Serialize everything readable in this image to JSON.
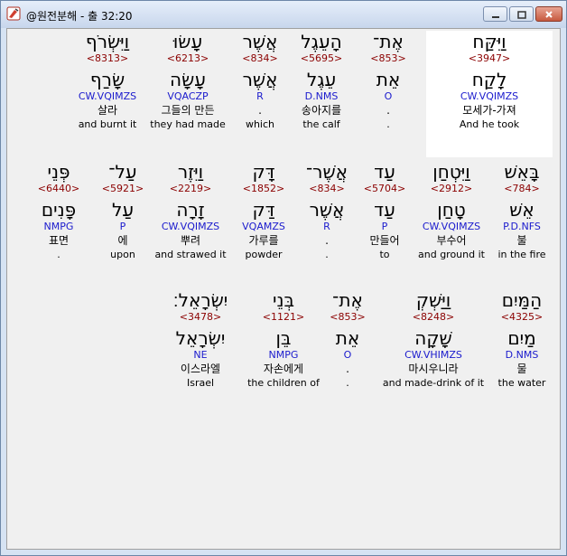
{
  "window": {
    "title": "@원전분해 - 출 32:20",
    "icon": "app-icon",
    "controls": [
      "minimize-icon",
      "maximize-icon",
      "close-icon"
    ]
  },
  "rows": [
    [
      {
        "heb": "וַיִּקַּח",
        "num": "<3947>",
        "lemma": "לָקַח",
        "morph": "CW.VQIMZS",
        "kor": "모세가-가져",
        "eng": "And he took",
        "highlight": true
      },
      {
        "heb": "אֶת־",
        "num": "<853>",
        "lemma": "אֵת",
        "morph": "O",
        "kor": ".",
        "eng": "."
      },
      {
        "heb": "הָעֵגֶל",
        "num": "<5695>",
        "lemma": "עֵגֶל",
        "morph": "D.NMS",
        "kor": "송아지를",
        "eng": "the calf"
      },
      {
        "heb": "אֲשֶׁר",
        "num": "<834>",
        "lemma": "אֲשֶׁר",
        "morph": "R",
        "kor": ".",
        "eng": "which"
      },
      {
        "heb": "עָשׂוּ",
        "num": "<6213>",
        "lemma": "עָשָׂה",
        "morph": "VQACZP",
        "kor": "그들의 만든",
        "eng": "they had made"
      },
      {
        "heb": "וַיִּשְׂרֹף",
        "num": "<8313>",
        "lemma": "שָׂרַף",
        "morph": "CW.VQIMZS",
        "kor": "살라",
        "eng": "and burnt it"
      }
    ],
    [
      {
        "heb": "בָּאֵשׁ",
        "num": "<784>",
        "lemma": "אֵשׁ",
        "morph": "P.D.NFS",
        "kor": "불",
        "eng": "in the fire"
      },
      {
        "heb": "וַיִּטְחַן",
        "num": "<2912>",
        "lemma": "טָחַן",
        "morph": "CW.VQIMZS",
        "kor": "부수어",
        "eng": "and ground it"
      },
      {
        "heb": "עַד",
        "num": "<5704>",
        "lemma": "עַד",
        "morph": "P",
        "kor": "만들어",
        "eng": "to"
      },
      {
        "heb": "אֲשֶׁר־",
        "num": "<834>",
        "lemma": "אֲשֶׁר",
        "morph": "R",
        "kor": ".",
        "eng": "."
      },
      {
        "heb": "דָּק",
        "num": "<1852>",
        "lemma": "דַּק",
        "morph": "VQAMZS",
        "kor": "가루를",
        "eng": "powder"
      },
      {
        "heb": "וַיִּזֶר",
        "num": "<2219>",
        "lemma": "זָרָה",
        "morph": "CW.VQIMZS",
        "kor": "뿌려",
        "eng": "and strawed it"
      },
      {
        "heb": "עַל־",
        "num": "<5921>",
        "lemma": "עַל",
        "morph": "P",
        "kor": "에",
        "eng": "upon"
      },
      {
        "heb": "פְּנֵי",
        "num": "<6440>",
        "lemma": "פָּנִים",
        "morph": "NMPG",
        "kor": "표면",
        "eng": "."
      }
    ],
    [
      {
        "heb": "הַמַּיִם",
        "num": "<4325>",
        "lemma": "מַיִם",
        "morph": "D.NMS",
        "kor": "물",
        "eng": "the water"
      },
      {
        "heb": "וַיַּשְׁקְ",
        "num": "<8248>",
        "lemma": "שָׁקָה",
        "morph": "CW.VHIMZS",
        "kor": "마시우니라",
        "eng": "and made-drink of it"
      },
      {
        "heb": "אֶת־",
        "num": "<853>",
        "lemma": "אֵת",
        "morph": "O",
        "kor": ".",
        "eng": "."
      },
      {
        "heb": "בְּנֵי",
        "num": "<1121>",
        "lemma": "בֵּן",
        "morph": "NMPG",
        "kor": "자손에게",
        "eng": "the children of"
      },
      {
        "heb": "יִשְׂרָאֵל׃",
        "num": "<3478>",
        "lemma": "יִשְׂרָאֵל",
        "morph": "NE",
        "kor": "이스라엘",
        "eng": "Israel"
      }
    ]
  ]
}
